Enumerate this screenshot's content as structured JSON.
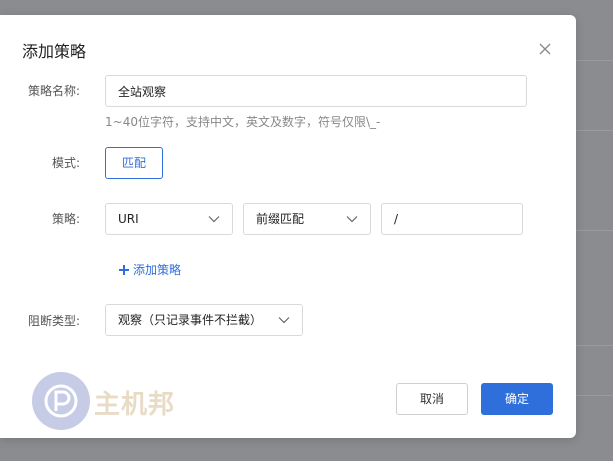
{
  "dialog": {
    "title": "添加策略"
  },
  "form": {
    "name_label": "策略名称:",
    "name_value": "全站观察",
    "name_hint": "1~40位字符，支持中文，英文及数字，符号仅限\\_-",
    "mode_label": "模式:",
    "mode_value": "匹配",
    "policy_label": "策略:",
    "policy_field": "URI",
    "policy_match": "前缀匹配",
    "policy_value": "/",
    "add_policy": "添加策略",
    "block_label": "阻断类型:",
    "block_value": "观察（只记录事件不拦截）"
  },
  "footer": {
    "cancel_label": "取消",
    "ok_label": "确定"
  },
  "watermark": {
    "text": "主机邦"
  },
  "colors": {
    "accent": "#2f6fdc",
    "overlay": "#8a8c90"
  }
}
